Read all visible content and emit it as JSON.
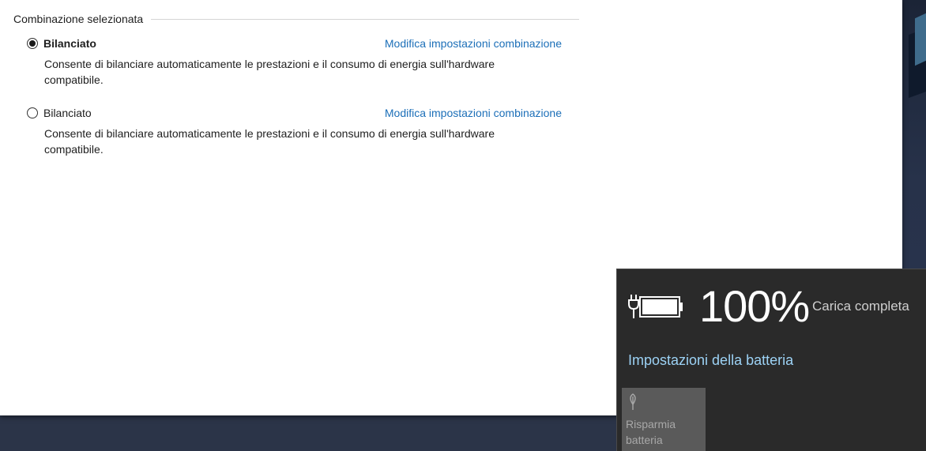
{
  "power_options": {
    "group_title": "Combinazione selezionata",
    "plans": [
      {
        "name": "Bilanciato",
        "selected": true,
        "link": "Modifica impostazioni combinazione",
        "description": "Consente di bilanciare automaticamente le prestazioni e il consumo di energia sull'hardware compatibile."
      },
      {
        "name": "Bilanciato",
        "selected": false,
        "link": "Modifica impostazioni combinazione",
        "description": "Consente di bilanciare automaticamente le prestazioni e il consumo di energia sull'hardware compatibile."
      }
    ]
  },
  "battery_flyout": {
    "percent": "100%",
    "status": "Carica completa",
    "settings_link": "Impostazioni della batteria",
    "saver_tile_label": "Risparmia batteria",
    "icons": {
      "battery": "battery-plugged-icon",
      "saver": "leaf-icon"
    },
    "colors": {
      "background": "#2a2a2a",
      "link": "#9cd2f5",
      "tile": "#5a5a5a"
    }
  },
  "colors": {
    "link": "#1c6fb8",
    "desktop": "#2b3448"
  }
}
